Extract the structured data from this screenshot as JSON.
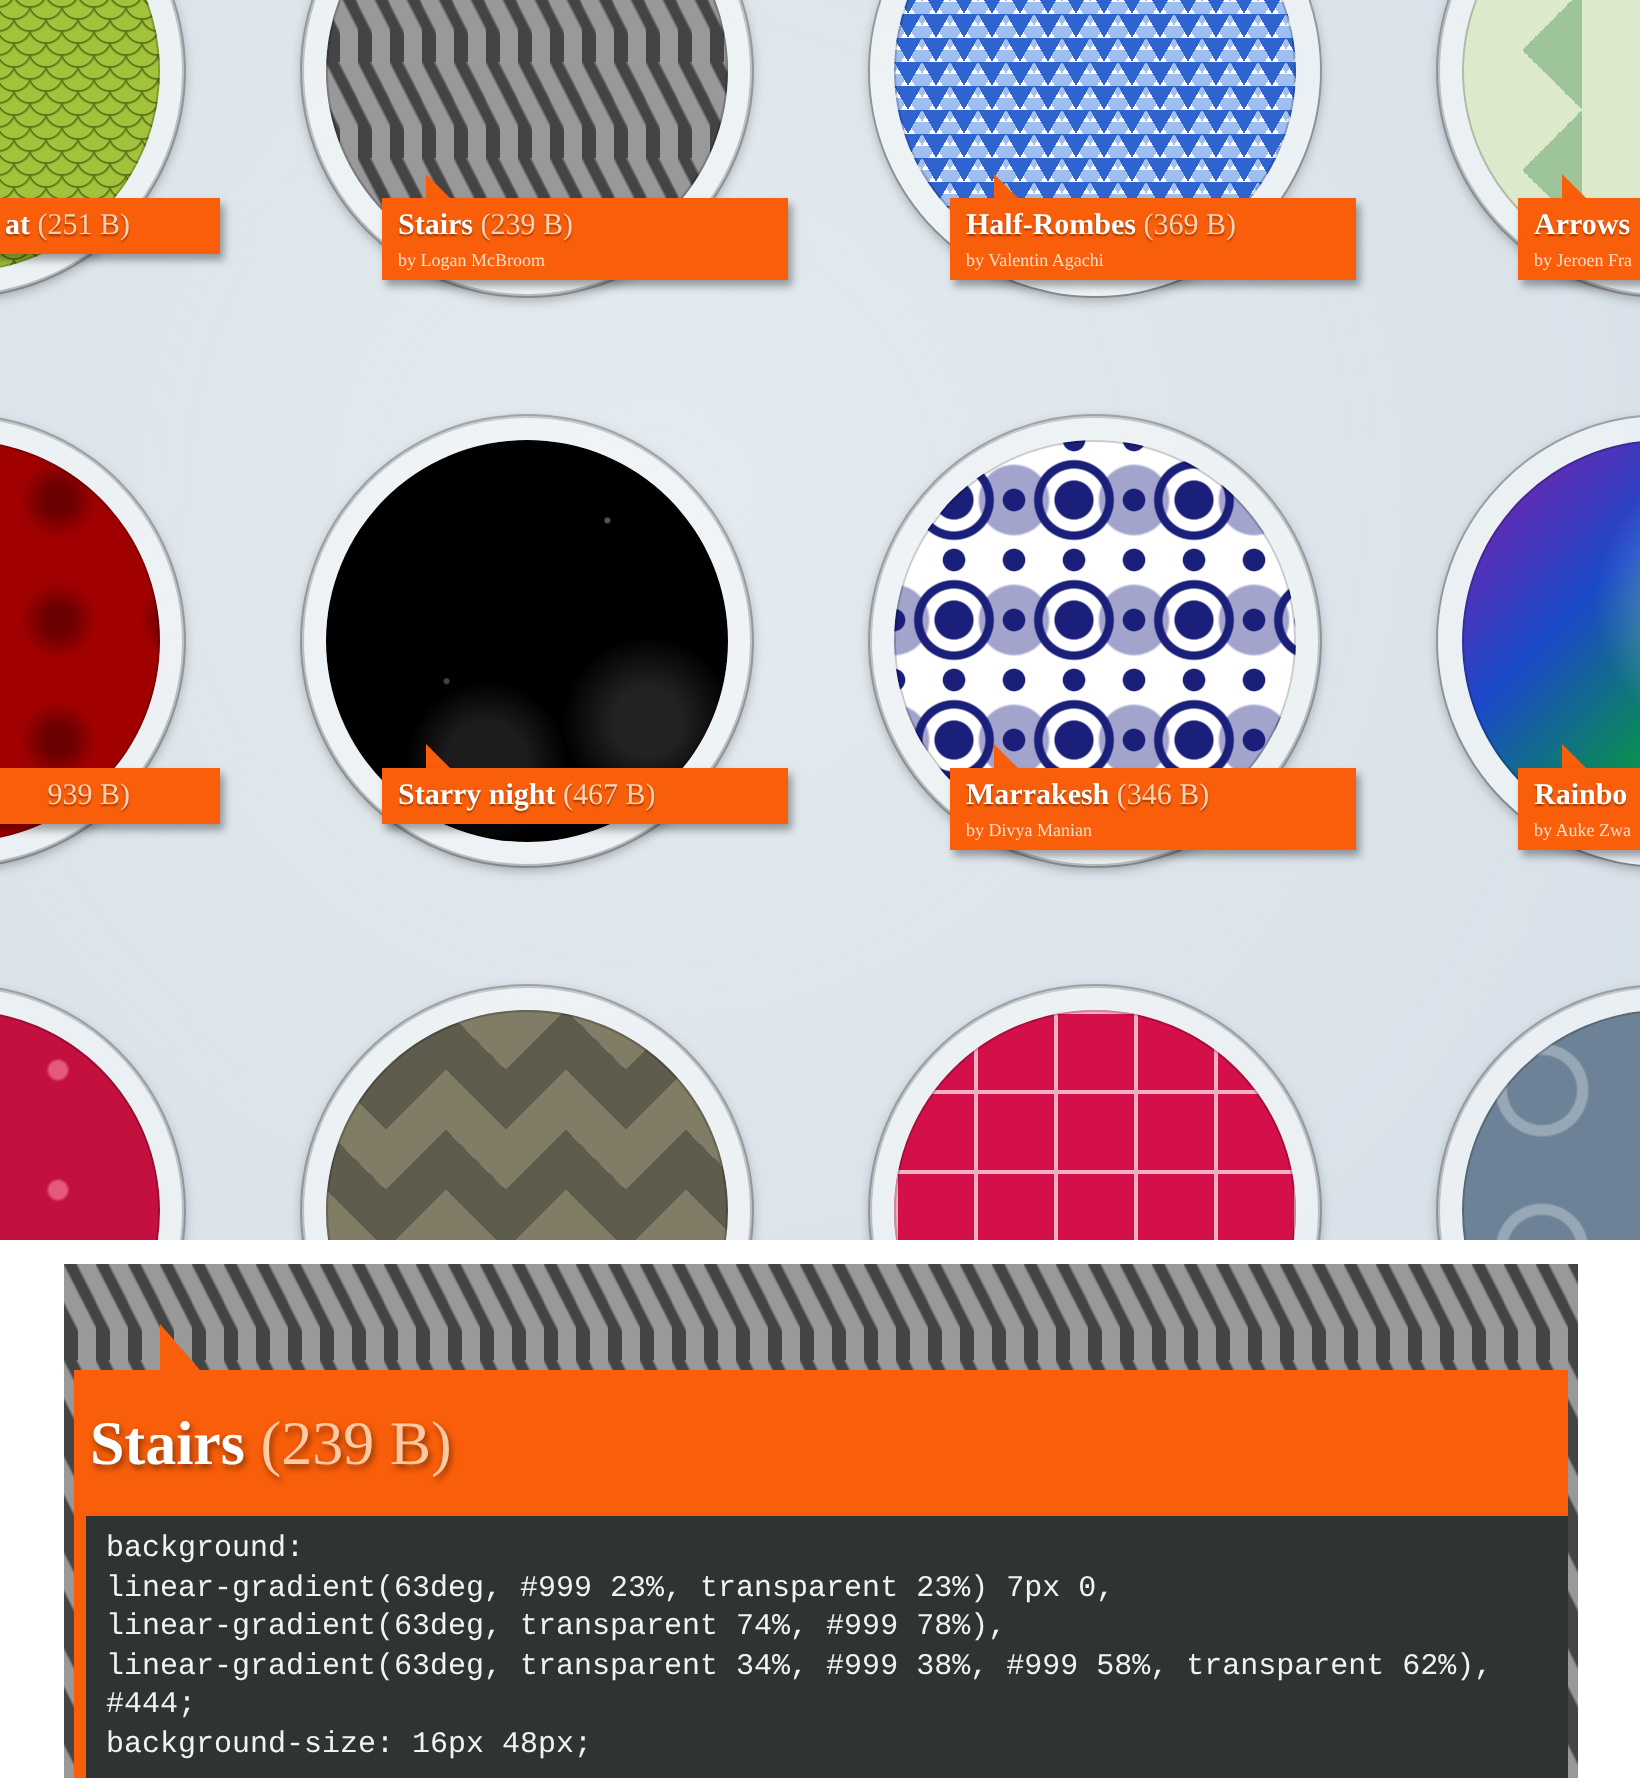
{
  "gallery": {
    "rows": [
      {
        "items": [
          {
            "kind": "scales",
            "name": "at",
            "size": "(251 B)"
          },
          {
            "kind": "stairs",
            "name": "Stairs",
            "size": "(239 B)",
            "author": "by Logan McBroom"
          },
          {
            "kind": "triangles",
            "name": "Half-Rombes",
            "size": "(369 B)",
            "author": "by Valentin Agachi"
          },
          {
            "kind": "arrows",
            "name": "Arrows",
            "author": "by Jeroen Fra"
          }
        ]
      },
      {
        "items": [
          {
            "kind": "checks",
            "size": "939 B)"
          },
          {
            "kind": "starry",
            "name": "Starry night",
            "size": "(467 B)"
          },
          {
            "kind": "marrakesh",
            "name": "Marrakesh",
            "size": "(346 B)",
            "author": "by Divya Manian"
          },
          {
            "kind": "rainbow",
            "name": "Rainbo",
            "author": "by Auke Zwa"
          }
        ]
      },
      {
        "items": [
          {
            "kind": "hearts"
          },
          {
            "kind": "argyle"
          },
          {
            "kind": "zigzag"
          },
          {
            "kind": "waves"
          }
        ]
      }
    ]
  },
  "detail": {
    "kind": "stairs",
    "name": "Stairs",
    "size": "(239 B)",
    "code": [
      "background:",
      "linear-gradient(63deg, #999 23%, transparent 23%) 7px 0,",
      "linear-gradient(63deg, transparent 74%, #999 78%),",
      "linear-gradient(63deg, transparent 34%, #999 38%, #999 58%, transparent 62%),",
      "#444;",
      "background-size: 16px 48px;"
    ]
  }
}
